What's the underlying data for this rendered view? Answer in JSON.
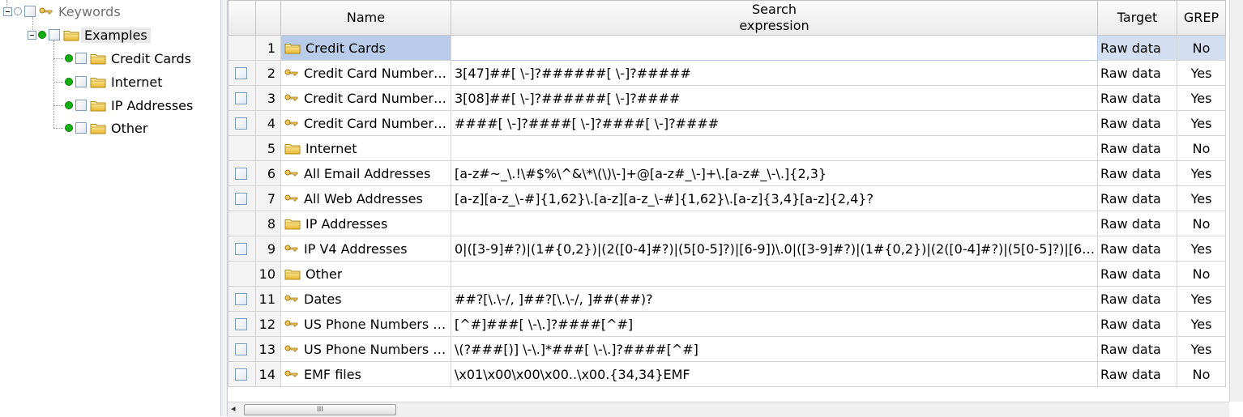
{
  "tree": {
    "root": {
      "label": "Keywords",
      "icon": "key-icon"
    },
    "examples": {
      "label": "Examples",
      "icon": "folder-icon"
    },
    "children": [
      {
        "label": "Credit Cards",
        "icon": "folder-icon"
      },
      {
        "label": "Internet",
        "icon": "folder-icon"
      },
      {
        "label": "IP Addresses",
        "icon": "folder-icon"
      },
      {
        "label": "Other",
        "icon": "folder-icon"
      }
    ]
  },
  "grid": {
    "headers": {
      "name": "Name",
      "expr_line1": "Search",
      "expr_line2": "expression",
      "target": "Target",
      "grep": "GREP"
    },
    "rows": [
      {
        "num": "1",
        "type": "folder",
        "name": "Credit Cards",
        "expr": "",
        "target": "Raw data",
        "grep": "No"
      },
      {
        "num": "2",
        "type": "key",
        "name": "Credit Card Number…",
        "expr": "3[47]##[ \\-]?######[ \\-]?#####",
        "target": "Raw data",
        "grep": "Yes"
      },
      {
        "num": "3",
        "type": "key",
        "name": "Credit Card Number…",
        "expr": "3[08]##[ \\-]?######[ \\-]?####",
        "target": "Raw data",
        "grep": "Yes"
      },
      {
        "num": "4",
        "type": "key",
        "name": "Credit Card Number…",
        "expr": "####[ \\-]?####[ \\-]?####[ \\-]?####",
        "target": "Raw data",
        "grep": "Yes"
      },
      {
        "num": "5",
        "type": "folder",
        "name": "Internet",
        "expr": "",
        "target": "Raw data",
        "grep": "No"
      },
      {
        "num": "6",
        "type": "key",
        "name": "All Email Addresses",
        "expr": "[a-z#~_\\.!\\#$%\\^&\\*\\(\\)\\-]+@[a-z#_\\-]+\\.[a-z#_\\-\\.]{2,3}",
        "target": "Raw data",
        "grep": "Yes"
      },
      {
        "num": "7",
        "type": "key",
        "name": "All Web Addresses",
        "expr": "[a-z][a-z_\\-#]{1,62}\\.[a-z][a-z_\\-#]{1,62}\\.[a-z]{3,4}[a-z]{2,4}?",
        "target": "Raw data",
        "grep": "Yes"
      },
      {
        "num": "8",
        "type": "folder",
        "name": "IP Addresses",
        "expr": "",
        "target": "Raw data",
        "grep": "No"
      },
      {
        "num": "9",
        "type": "key",
        "name": "IP V4 Addresses",
        "expr": "0|([3-9]#?)|(1#{0,2})|(2([0-4]#?)|(5[0-5]?)|[6-9])\\.0|([3-9]#?)|(1#{0,2})|(2([0-4]#?)|(5[0-5]?)|[6…",
        "target": "Raw data",
        "grep": "Yes"
      },
      {
        "num": "10",
        "type": "folder",
        "name": "Other",
        "expr": "",
        "target": "Raw data",
        "grep": "No"
      },
      {
        "num": "11",
        "type": "key",
        "name": "Dates",
        "expr": "##?[\\.\\-/, ]##?[\\.\\-/, ]##(##)?",
        "target": "Raw data",
        "grep": "Yes"
      },
      {
        "num": "12",
        "type": "key",
        "name": "US Phone Numbers …",
        "expr": "[^#]###[ \\-\\.]?####[^#]",
        "target": "Raw data",
        "grep": "Yes"
      },
      {
        "num": "13",
        "type": "key",
        "name": "US Phone Numbers …",
        "expr": "\\(?###[)] \\-\\.]*###[ \\-\\.]?####[^#]",
        "target": "Raw data",
        "grep": "Yes"
      },
      {
        "num": "14",
        "type": "key",
        "name": "EMF files",
        "expr": " \\x01\\x00\\x00\\x00..\\x00.{34,34}EMF",
        "target": "Raw data",
        "grep": "No"
      }
    ]
  },
  "scrollbar": {
    "thumb_grip": "III"
  }
}
